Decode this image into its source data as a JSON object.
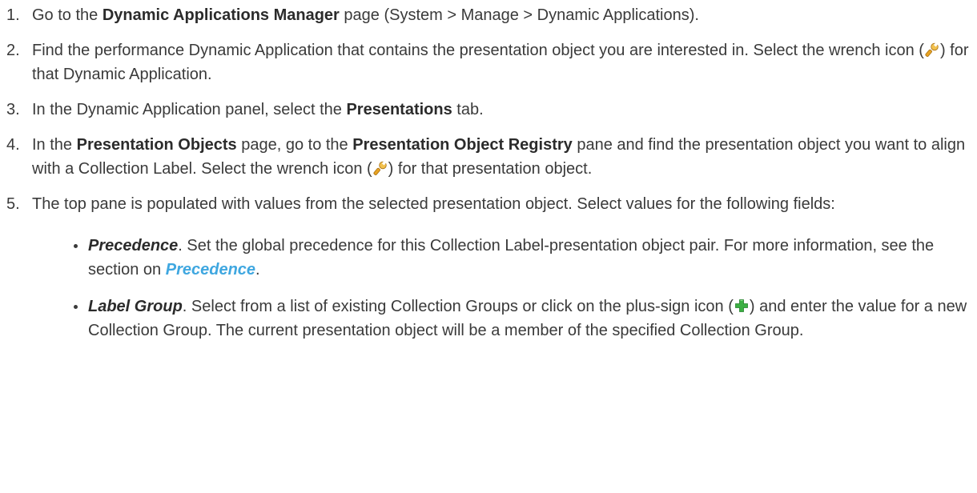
{
  "steps": [
    {
      "num": "1.",
      "t1": "Go to the ",
      "b1": "Dynamic Applications Manager",
      "t2": " page (System > Manage > Dynamic Applications)."
    },
    {
      "num": "2.",
      "t1": "Find the performance Dynamic Application that contains the presentation object you are interested in. Select the wrench icon (",
      "icon": "wrench-icon",
      "t2": ") for that Dynamic Application."
    },
    {
      "num": "3.",
      "t1": "In the Dynamic Application panel, select the ",
      "b1": "Presentations",
      "t2": " tab."
    },
    {
      "num": "4.",
      "t1": "In the ",
      "b1": "Presentation Objects",
      "t2": " page, go to the ",
      "b2": "Presentation Object Registry",
      "t3": " pane and find the presentation object you want to align with a Collection Label. Select the wrench icon (",
      "icon": "wrench-icon",
      "t4": ") for that presentation object."
    },
    {
      "num": "5.",
      "t1": "The top pane is populated with values from the selected presentation object. Select values for the following fields:",
      "fields": [
        {
          "name": "Precedence",
          "t1": ". Set the global precedence for this Collection Label-presentation object pair. For more information, see the section on ",
          "link": "Precedence",
          "t2": "."
        },
        {
          "name": "Label Group",
          "t1": ". Select from a list of existing Collection Groups or click on the plus-sign icon (",
          "icon": "plus-icon",
          "t2": ") and enter the value for a new Collection Group. The current presentation object will be a member of the specified Collection Group."
        }
      ]
    }
  ],
  "colors": {
    "text": "#3a3a3a",
    "link": "#3fa7e0",
    "wrench": "#e8a323",
    "plus": "#3cb043"
  }
}
